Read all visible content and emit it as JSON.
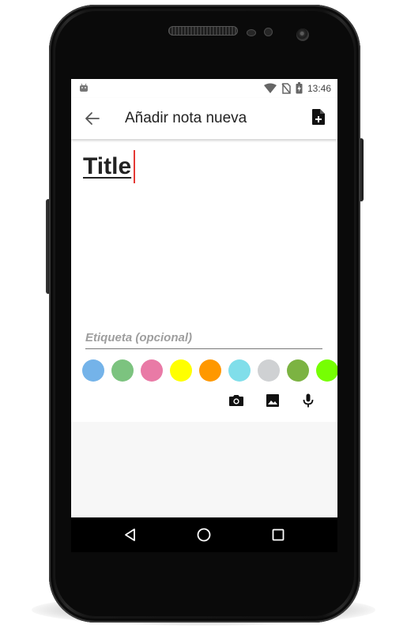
{
  "status_bar": {
    "time": "13:46",
    "icons": [
      "android-notification-icon",
      "wifi-icon",
      "no-sim-icon",
      "battery-charging-icon"
    ]
  },
  "toolbar": {
    "title": "Añadir nota nueva",
    "back_icon": "arrow-back-icon",
    "action_icon": "note-add-icon"
  },
  "editor": {
    "title_value": "Title",
    "tag_placeholder": "Etiqueta (opcional)",
    "colors": [
      "#74b3e9",
      "#7cc37f",
      "#e97aa6",
      "#ffff00",
      "#ff9800",
      "#80deea",
      "#cfd1d3",
      "#7cb342",
      "#76ff03"
    ],
    "media_icons": [
      "camera-icon",
      "image-icon",
      "microphone-icon"
    ]
  },
  "navigation": {
    "buttons": [
      "back-triangle-icon",
      "home-circle-icon",
      "recents-square-icon"
    ]
  }
}
